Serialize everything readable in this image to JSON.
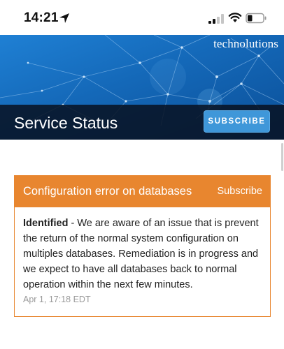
{
  "status_bar": {
    "time": "14:21",
    "icons": [
      "location-arrow-icon",
      "cellular-signal-icon",
      "wifi-icon",
      "battery-icon"
    ]
  },
  "header": {
    "brand": "technolutions",
    "title": "Service Status",
    "subscribe_label": "SUBSCRIBE"
  },
  "incident": {
    "title": "Configuration error on databases",
    "subscribe_label": "Subscribe",
    "status": "Identified",
    "separator": " - ",
    "message": "We are aware of an issue that is prevent the return of the normal system configuration on multiples databases. Remediation is in progress and we expect to have all databases back to normal operation within the next few minutes.",
    "timestamp": "Apr 1, 17:18 EDT"
  },
  "colors": {
    "incident_accent": "#e8862f",
    "subscribe_button": "#3f97d9",
    "hero_blue": "#1468b8",
    "title_band": "#081222"
  }
}
